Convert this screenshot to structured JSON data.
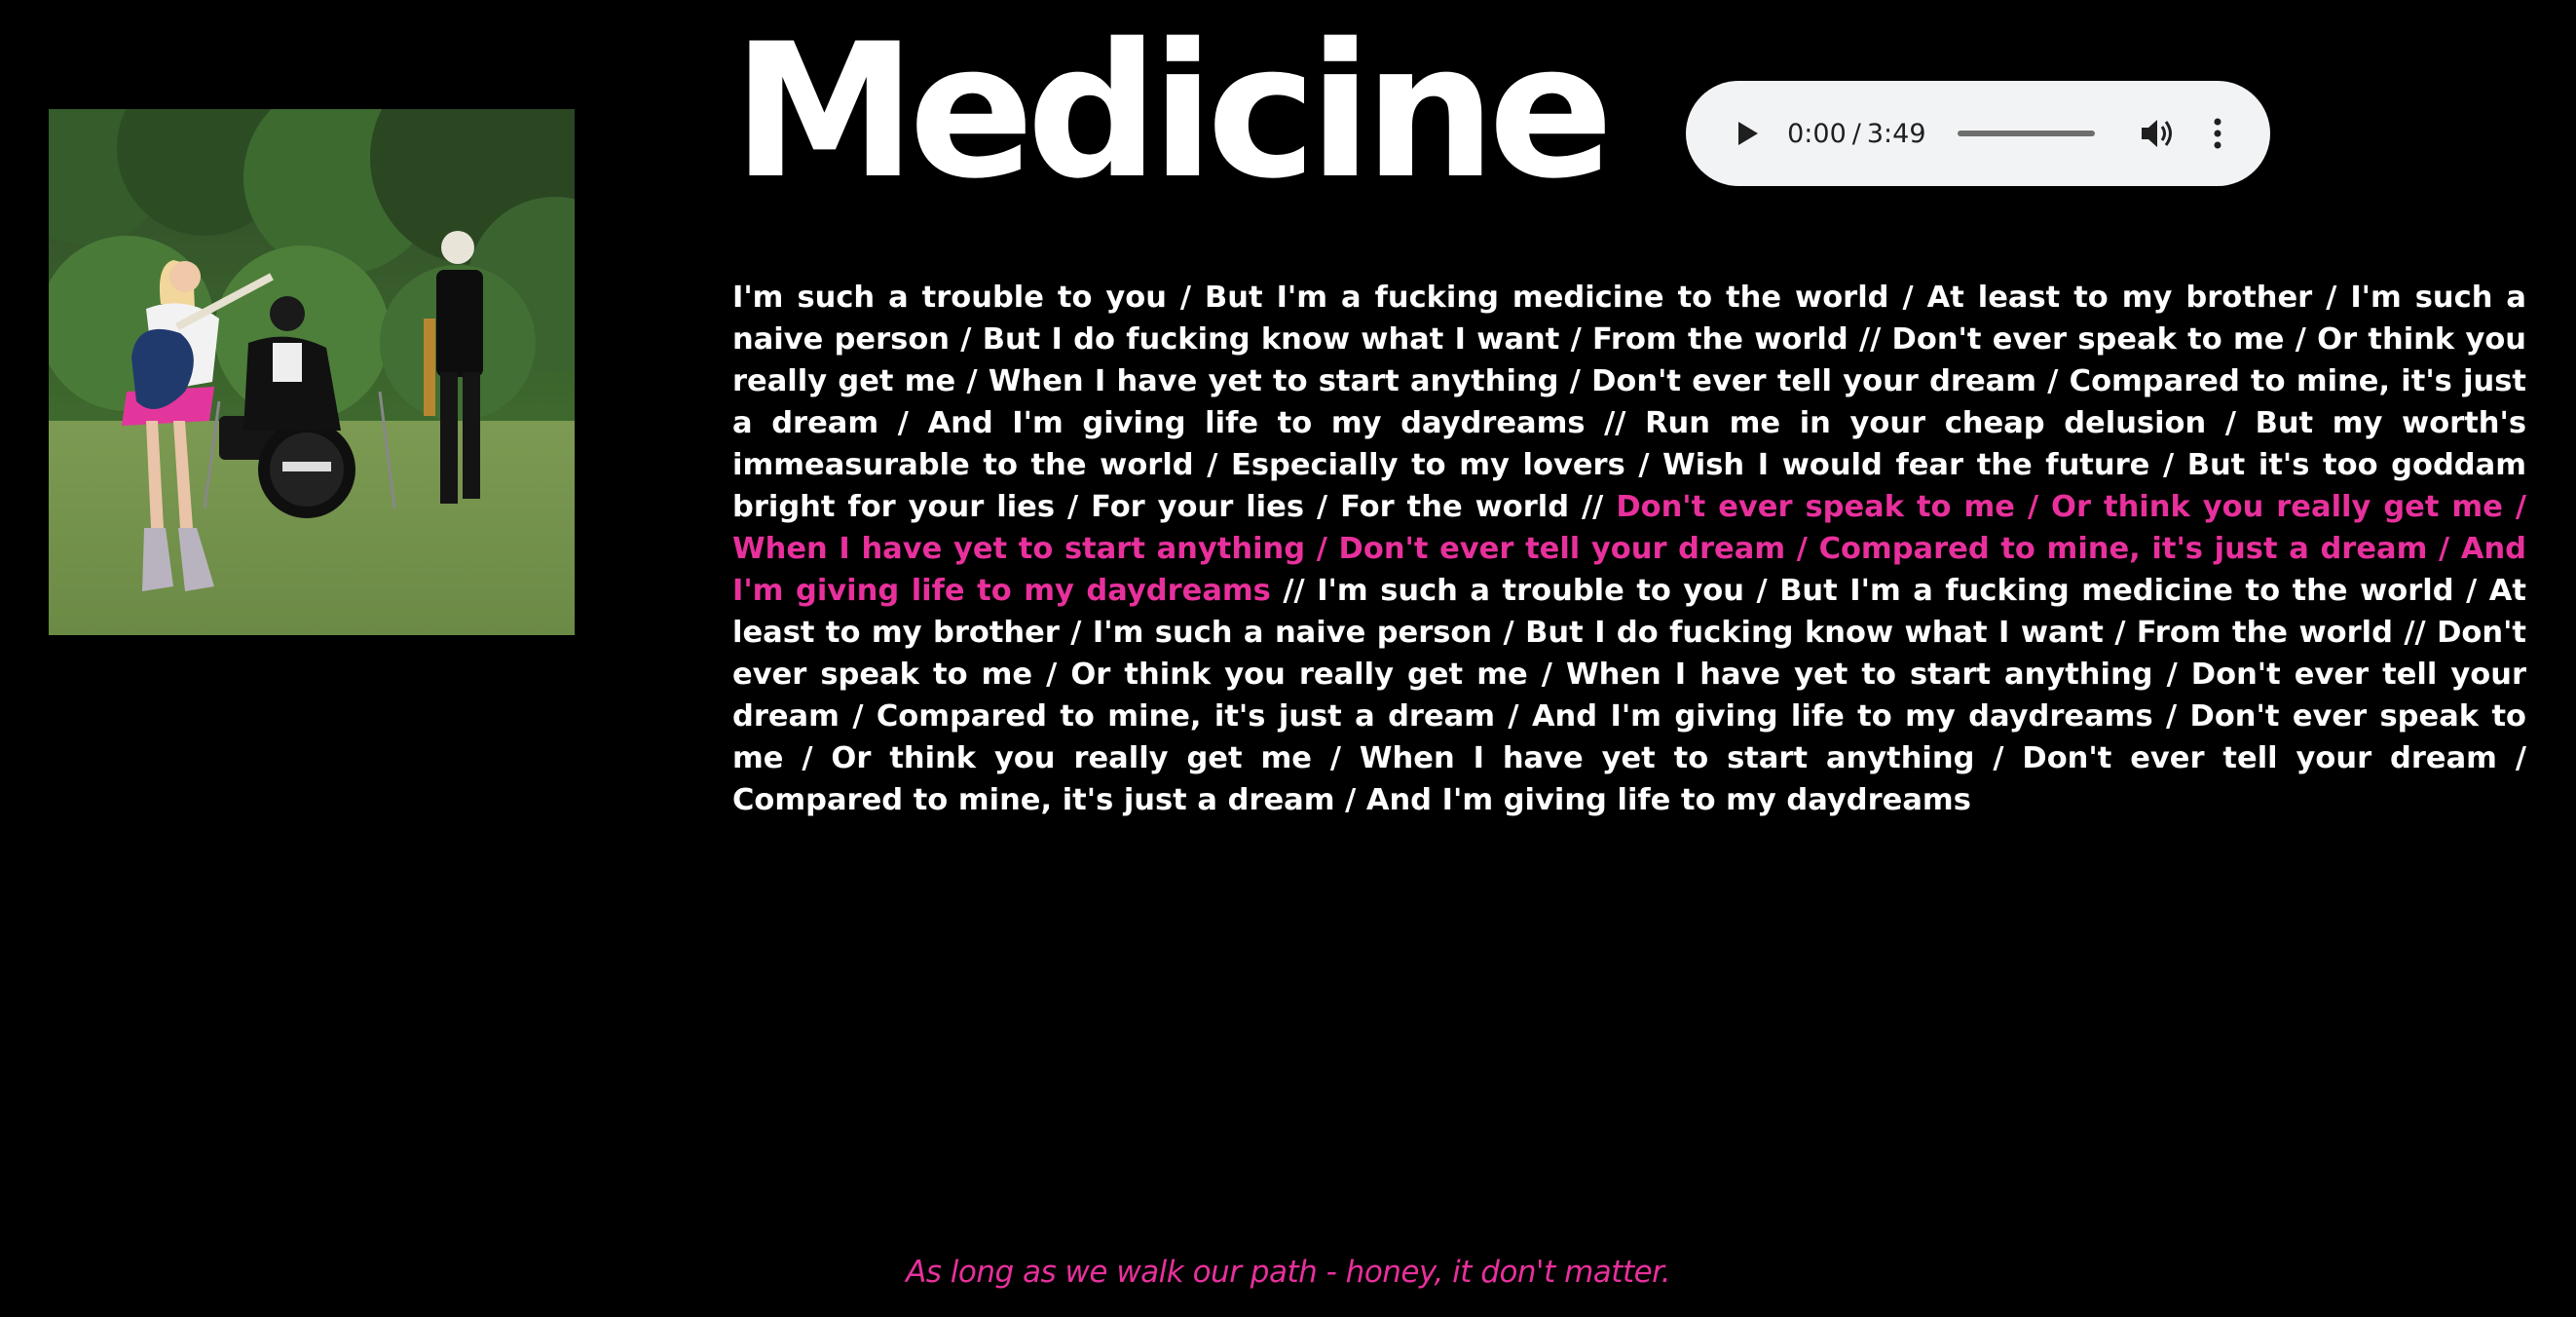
{
  "song": {
    "title": "Medicine",
    "cover_image": "band-in-field-photo"
  },
  "player": {
    "current_time": "0:00",
    "separator": "/",
    "duration": "3:49",
    "progress_fraction": 0,
    "play_icon": "play-icon",
    "volume_icon": "volume-icon",
    "more_icon": "more-options-icon"
  },
  "lyrics": {
    "part1": "I'm such a trouble to you / But I'm a fucking medicine to the world / At least to my brother / I'm such a naive person / But I do fucking know what I want / From the world // Don't ever speak to me / Or think you really get me / When I have yet to start anything / Don't ever tell your dream / Compared to mine, it's just a dream / And I'm giving life to my daydreams // Run me in your cheap delusion / But my worth's immeasurable to the world / Especially to my lovers / Wish I would fear the future / But it's too goddam bright for your lies / For your lies / For the world // ",
    "highlighted": "Don't ever speak to me / Or think you really get me / When I have yet to start anything / Don't ever tell your dream / Compared to mine, it's just a dream / And I'm giving life to my daydreams",
    "part2": " // I'm such a trouble to you / But I'm a fucking medicine to the world / At least to my brother / I'm such a naive person / But I do fucking know what I want / From the world // Don't ever speak to me / Or think you really get me / When I have yet to start anything / Don't ever tell your dream / Compared to mine, it's just a dream / And I'm giving life to my daydreams / Don't ever speak to me / Or think you really get me / When I have yet to start anything / Don't ever tell your dream / Compared to mine, it's just a dream / And I'm giving life to my daydreams"
  },
  "footer": {
    "tagline": "As long as we walk our path - honey, it don't matter."
  },
  "colors": {
    "background": "#000000",
    "text": "#ffffff",
    "accent": "#e8309c",
    "player_bg": "#f1f3f4"
  }
}
